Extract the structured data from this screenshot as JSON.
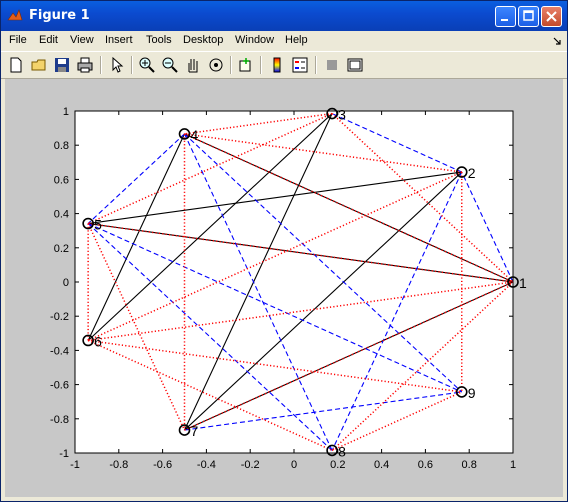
{
  "window": {
    "title": "Figure 1"
  },
  "menu": [
    "File",
    "Edit",
    "View",
    "Insert",
    "Tools",
    "Desktop",
    "Window",
    "Help"
  ],
  "toolbar_icons": [
    "new-figure-icon",
    "open-file-icon",
    "save-icon",
    "print-icon",
    "select-arrow-icon",
    "zoom-in-icon",
    "zoom-out-icon",
    "pan-hand-icon",
    "rotate-3d-icon",
    "data-cursor-icon",
    "colorbar-icon",
    "legend-icon",
    "hide-plot-tools-icon",
    "show-plot-tools-icon"
  ],
  "chart_data": {
    "type": "line",
    "title": "",
    "xlabel": "",
    "ylabel": "",
    "xlim": [
      -1,
      1
    ],
    "ylim": [
      -1,
      1
    ],
    "xticks": [
      "-1",
      "-0.8",
      "-0.6",
      "-0.4",
      "-0.2",
      "0",
      "0.2",
      "0.4",
      "0.6",
      "0.8",
      "1"
    ],
    "yticks": [
      "1",
      "0.8",
      "0.6",
      "0.4",
      "0.2",
      "0",
      "-0.2",
      "-0.4",
      "-0.6",
      "-0.8",
      "-1"
    ],
    "nodes": [
      {
        "label": "1",
        "x": 1.0,
        "y": 0.0
      },
      {
        "label": "2",
        "x": 0.766,
        "y": 0.643
      },
      {
        "label": "3",
        "x": 0.174,
        "y": 0.985
      },
      {
        "label": "4",
        "x": -0.5,
        "y": 0.866
      },
      {
        "label": "5",
        "x": -0.94,
        "y": 0.342
      },
      {
        "label": "6",
        "x": -0.94,
        "y": -0.342
      },
      {
        "label": "7",
        "x": -0.5,
        "y": -0.866
      },
      {
        "label": "8",
        "x": 0.174,
        "y": -0.985
      },
      {
        "label": "9",
        "x": 0.766,
        "y": -0.643
      }
    ],
    "edge_styles": {
      "black-solid": {
        "color": "#000000"
      },
      "blue-dashed": {
        "color": "#0000ff"
      },
      "red-dotted": {
        "color": "#ff0000"
      }
    },
    "edges": [
      {
        "from": "1",
        "to": "4",
        "style": "black-solid"
      },
      {
        "from": "1",
        "to": "5",
        "style": "black-solid"
      },
      {
        "from": "1",
        "to": "7",
        "style": "black-solid"
      },
      {
        "from": "2",
        "to": "5",
        "style": "black-solid"
      },
      {
        "from": "2",
        "to": "7",
        "style": "black-solid"
      },
      {
        "from": "3",
        "to": "6",
        "style": "black-solid"
      },
      {
        "from": "3",
        "to": "7",
        "style": "black-solid"
      },
      {
        "from": "4",
        "to": "6",
        "style": "black-solid"
      },
      {
        "from": "1",
        "to": "2",
        "style": "blue-dashed"
      },
      {
        "from": "2",
        "to": "3",
        "style": "blue-dashed"
      },
      {
        "from": "4",
        "to": "5",
        "style": "blue-dashed"
      },
      {
        "from": "4",
        "to": "8",
        "style": "blue-dashed"
      },
      {
        "from": "4",
        "to": "9",
        "style": "blue-dashed"
      },
      {
        "from": "5",
        "to": "8",
        "style": "blue-dashed"
      },
      {
        "from": "5",
        "to": "9",
        "style": "blue-dashed"
      },
      {
        "from": "7",
        "to": "9",
        "style": "blue-dashed"
      },
      {
        "from": "2",
        "to": "8",
        "style": "blue-dashed"
      },
      {
        "from": "3",
        "to": "4",
        "style": "red-dotted"
      },
      {
        "from": "3",
        "to": "5",
        "style": "red-dotted"
      },
      {
        "from": "3",
        "to": "1",
        "style": "red-dotted"
      },
      {
        "from": "2",
        "to": "9",
        "style": "red-dotted"
      },
      {
        "from": "2",
        "to": "6",
        "style": "red-dotted"
      },
      {
        "from": "1",
        "to": "6",
        "style": "red-dotted"
      },
      {
        "from": "1",
        "to": "8",
        "style": "red-dotted"
      },
      {
        "from": "4",
        "to": "2",
        "style": "red-dotted"
      },
      {
        "from": "4",
        "to": "7",
        "style": "red-dotted"
      },
      {
        "from": "5",
        "to": "6",
        "style": "red-dotted"
      },
      {
        "from": "5",
        "to": "7",
        "style": "red-dotted"
      },
      {
        "from": "5",
        "to": "1",
        "style": "red-dotted"
      },
      {
        "from": "6",
        "to": "9",
        "style": "red-dotted"
      },
      {
        "from": "6",
        "to": "8",
        "style": "red-dotted"
      },
      {
        "from": "7",
        "to": "1",
        "style": "red-dotted"
      },
      {
        "from": "8",
        "to": "9",
        "style": "red-dotted"
      },
      {
        "from": "4",
        "to": "1",
        "style": "red-dotted"
      }
    ]
  }
}
